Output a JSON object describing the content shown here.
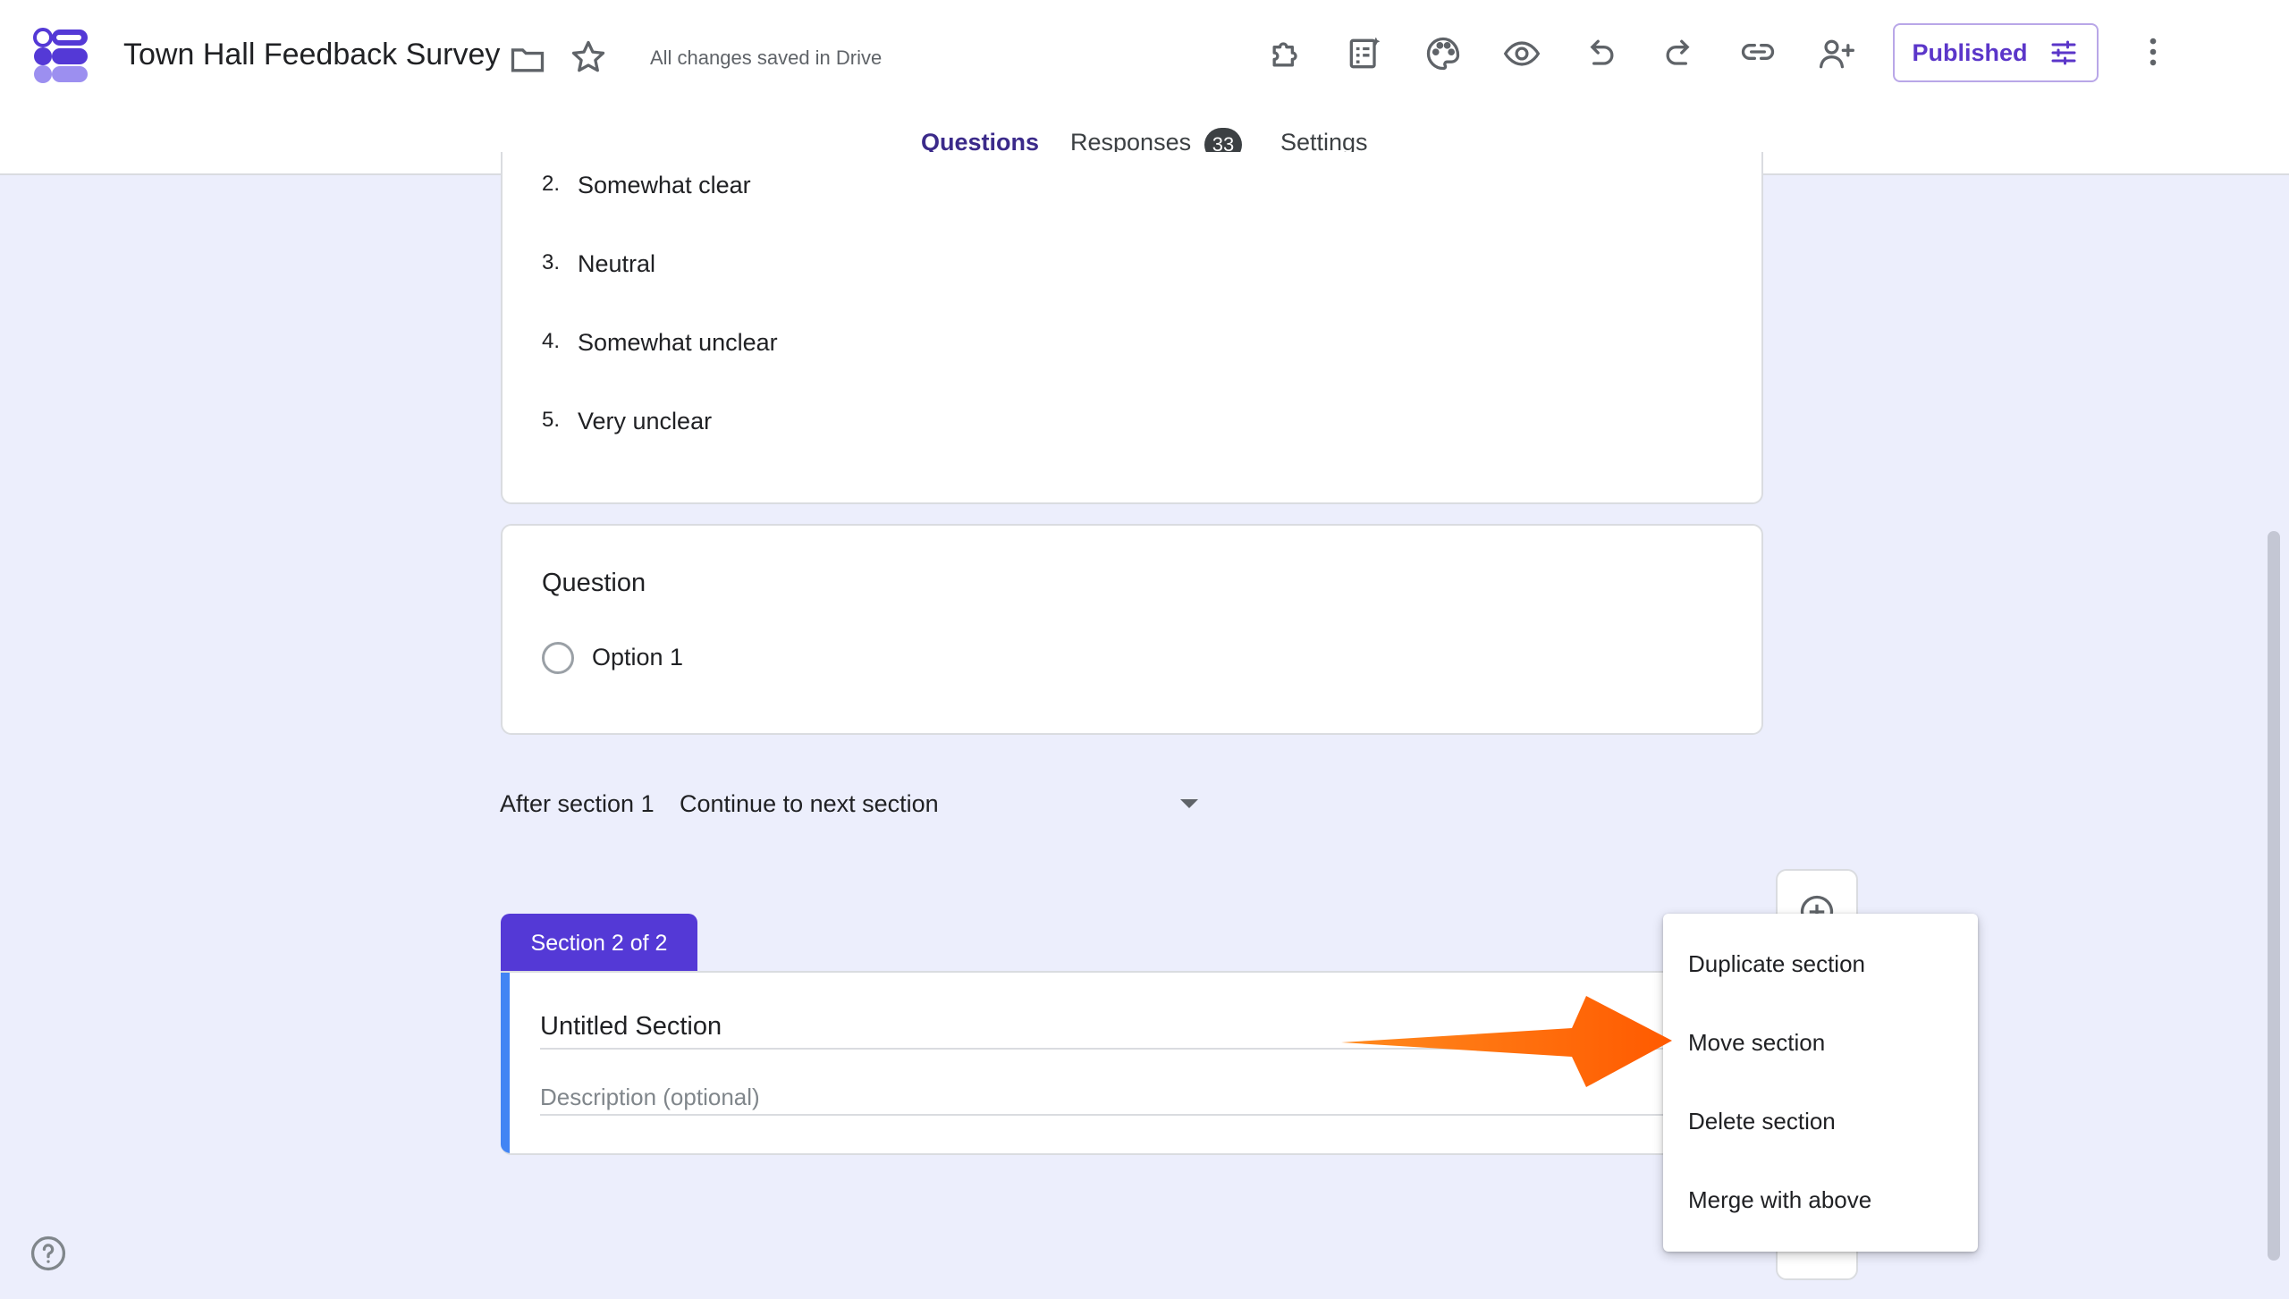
{
  "app": {
    "title": "Town Hall Feedback Survey",
    "save_status": "All changes saved in Drive",
    "publish_button": "Published"
  },
  "tabs": {
    "questions": "Questions",
    "responses": "Responses",
    "responses_count": "33",
    "settings": "Settings"
  },
  "scale_options": [
    {
      "num": "2.",
      "label": "Somewhat clear"
    },
    {
      "num": "3.",
      "label": "Neutral"
    },
    {
      "num": "4.",
      "label": "Somewhat unclear"
    },
    {
      "num": "5.",
      "label": "Very unclear"
    }
  ],
  "question_card": {
    "title": "Question",
    "option": "Option 1"
  },
  "after_section": {
    "label": "After section 1",
    "value": "Continue to next section"
  },
  "section": {
    "tab_label": "Section 2 of 2",
    "title": "Untitled Section",
    "description_placeholder": "Description (optional)"
  },
  "context_menu": {
    "items": [
      "Duplicate section",
      "Move section",
      "Delete section",
      "Merge with above"
    ]
  },
  "colors": {
    "accent": "#5439d6",
    "arrow": "#ff6a00",
    "background": "#eceefc"
  }
}
